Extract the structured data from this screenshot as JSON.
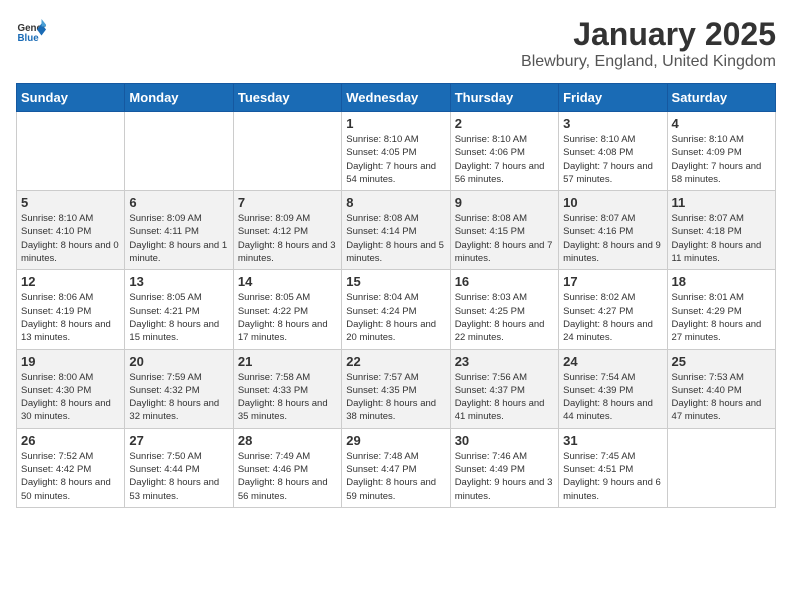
{
  "header": {
    "logo": {
      "general": "General",
      "blue": "Blue"
    },
    "title": "January 2025",
    "subtitle": "Blewbury, England, United Kingdom"
  },
  "weekdays": [
    "Sunday",
    "Monday",
    "Tuesday",
    "Wednesday",
    "Thursday",
    "Friday",
    "Saturday"
  ],
  "weeks": [
    [
      {
        "day": "",
        "info": ""
      },
      {
        "day": "",
        "info": ""
      },
      {
        "day": "",
        "info": ""
      },
      {
        "day": "1",
        "info": "Sunrise: 8:10 AM\nSunset: 4:05 PM\nDaylight: 7 hours\nand 54 minutes."
      },
      {
        "day": "2",
        "info": "Sunrise: 8:10 AM\nSunset: 4:06 PM\nDaylight: 7 hours\nand 56 minutes."
      },
      {
        "day": "3",
        "info": "Sunrise: 8:10 AM\nSunset: 4:08 PM\nDaylight: 7 hours\nand 57 minutes."
      },
      {
        "day": "4",
        "info": "Sunrise: 8:10 AM\nSunset: 4:09 PM\nDaylight: 7 hours\nand 58 minutes."
      }
    ],
    [
      {
        "day": "5",
        "info": "Sunrise: 8:10 AM\nSunset: 4:10 PM\nDaylight: 8 hours\nand 0 minutes."
      },
      {
        "day": "6",
        "info": "Sunrise: 8:09 AM\nSunset: 4:11 PM\nDaylight: 8 hours\nand 1 minute."
      },
      {
        "day": "7",
        "info": "Sunrise: 8:09 AM\nSunset: 4:12 PM\nDaylight: 8 hours\nand 3 minutes."
      },
      {
        "day": "8",
        "info": "Sunrise: 8:08 AM\nSunset: 4:14 PM\nDaylight: 8 hours\nand 5 minutes."
      },
      {
        "day": "9",
        "info": "Sunrise: 8:08 AM\nSunset: 4:15 PM\nDaylight: 8 hours\nand 7 minutes."
      },
      {
        "day": "10",
        "info": "Sunrise: 8:07 AM\nSunset: 4:16 PM\nDaylight: 8 hours\nand 9 minutes."
      },
      {
        "day": "11",
        "info": "Sunrise: 8:07 AM\nSunset: 4:18 PM\nDaylight: 8 hours\nand 11 minutes."
      }
    ],
    [
      {
        "day": "12",
        "info": "Sunrise: 8:06 AM\nSunset: 4:19 PM\nDaylight: 8 hours\nand 13 minutes."
      },
      {
        "day": "13",
        "info": "Sunrise: 8:05 AM\nSunset: 4:21 PM\nDaylight: 8 hours\nand 15 minutes."
      },
      {
        "day": "14",
        "info": "Sunrise: 8:05 AM\nSunset: 4:22 PM\nDaylight: 8 hours\nand 17 minutes."
      },
      {
        "day": "15",
        "info": "Sunrise: 8:04 AM\nSunset: 4:24 PM\nDaylight: 8 hours\nand 20 minutes."
      },
      {
        "day": "16",
        "info": "Sunrise: 8:03 AM\nSunset: 4:25 PM\nDaylight: 8 hours\nand 22 minutes."
      },
      {
        "day": "17",
        "info": "Sunrise: 8:02 AM\nSunset: 4:27 PM\nDaylight: 8 hours\nand 24 minutes."
      },
      {
        "day": "18",
        "info": "Sunrise: 8:01 AM\nSunset: 4:29 PM\nDaylight: 8 hours\nand 27 minutes."
      }
    ],
    [
      {
        "day": "19",
        "info": "Sunrise: 8:00 AM\nSunset: 4:30 PM\nDaylight: 8 hours\nand 30 minutes."
      },
      {
        "day": "20",
        "info": "Sunrise: 7:59 AM\nSunset: 4:32 PM\nDaylight: 8 hours\nand 32 minutes."
      },
      {
        "day": "21",
        "info": "Sunrise: 7:58 AM\nSunset: 4:33 PM\nDaylight: 8 hours\nand 35 minutes."
      },
      {
        "day": "22",
        "info": "Sunrise: 7:57 AM\nSunset: 4:35 PM\nDaylight: 8 hours\nand 38 minutes."
      },
      {
        "day": "23",
        "info": "Sunrise: 7:56 AM\nSunset: 4:37 PM\nDaylight: 8 hours\nand 41 minutes."
      },
      {
        "day": "24",
        "info": "Sunrise: 7:54 AM\nSunset: 4:39 PM\nDaylight: 8 hours\nand 44 minutes."
      },
      {
        "day": "25",
        "info": "Sunrise: 7:53 AM\nSunset: 4:40 PM\nDaylight: 8 hours\nand 47 minutes."
      }
    ],
    [
      {
        "day": "26",
        "info": "Sunrise: 7:52 AM\nSunset: 4:42 PM\nDaylight: 8 hours\nand 50 minutes."
      },
      {
        "day": "27",
        "info": "Sunrise: 7:50 AM\nSunset: 4:44 PM\nDaylight: 8 hours\nand 53 minutes."
      },
      {
        "day": "28",
        "info": "Sunrise: 7:49 AM\nSunset: 4:46 PM\nDaylight: 8 hours\nand 56 minutes."
      },
      {
        "day": "29",
        "info": "Sunrise: 7:48 AM\nSunset: 4:47 PM\nDaylight: 8 hours\nand 59 minutes."
      },
      {
        "day": "30",
        "info": "Sunrise: 7:46 AM\nSunset: 4:49 PM\nDaylight: 9 hours\nand 3 minutes."
      },
      {
        "day": "31",
        "info": "Sunrise: 7:45 AM\nSunset: 4:51 PM\nDaylight: 9 hours\nand 6 minutes."
      },
      {
        "day": "",
        "info": ""
      }
    ]
  ]
}
